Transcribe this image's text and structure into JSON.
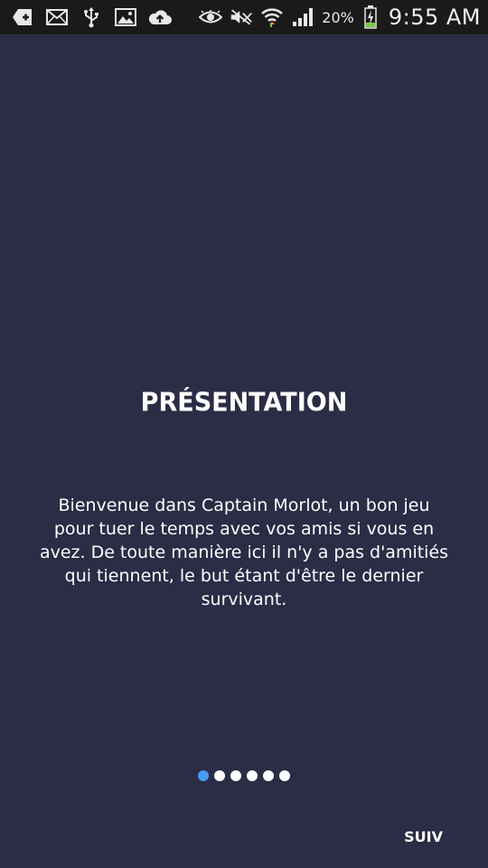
{
  "status_bar": {
    "left_icons": [
      "add-icon",
      "mail-icon",
      "usb-icon",
      "image-icon",
      "upload-icon"
    ],
    "right_icons": [
      "eye-icon",
      "mute-icon",
      "wifi-icon",
      "signal-icon",
      "battery-charging-icon"
    ],
    "battery_percent": "20%",
    "time": "9:55 AM"
  },
  "onboarding": {
    "title": "PRÉSENTATION",
    "body": "Bienvenue dans Captain Morlot, un bon jeu pour tuer le temps avec vos amis si vous en avez. De toute manière ici il n'y a pas d'amitiés qui tiennent, le but étant d'être le dernier survivant.",
    "page_count": 6,
    "current_page": 1,
    "next_label": "SUIV"
  },
  "colors": {
    "background": "#2b2c45",
    "status_bar": "#1a1a1a",
    "active_dot": "#4a9cf0",
    "inactive_dot": "#ffffff",
    "text": "#ffffff"
  }
}
